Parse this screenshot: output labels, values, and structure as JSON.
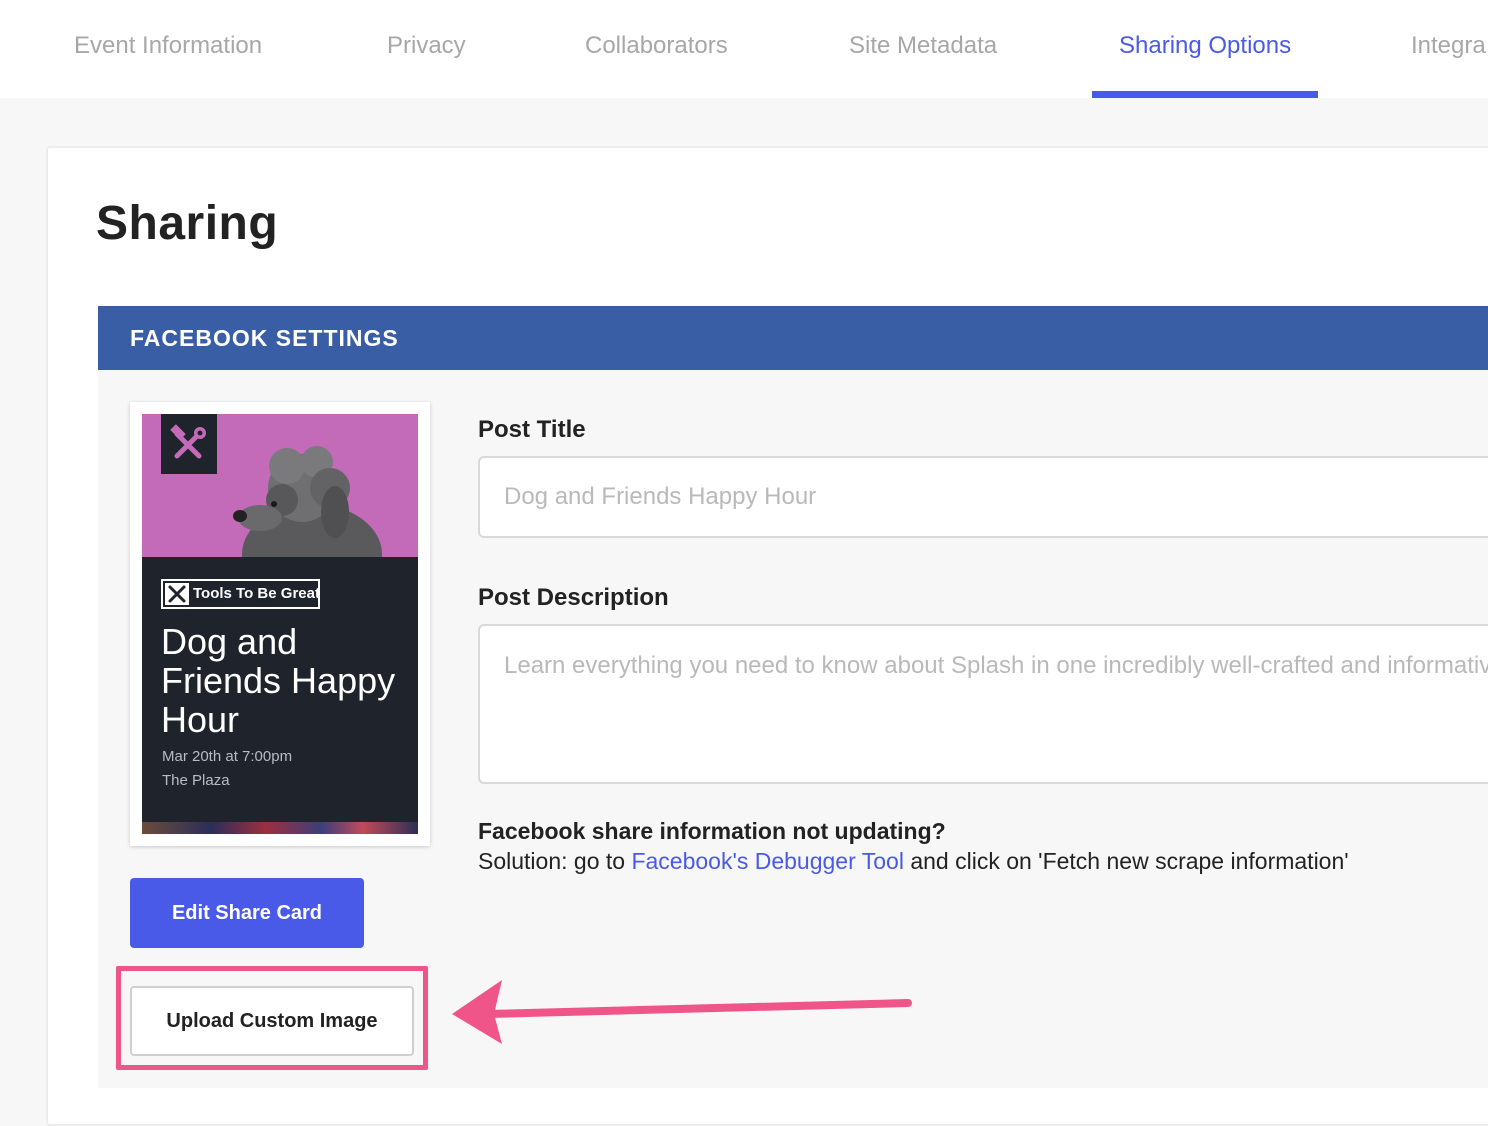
{
  "tabs": [
    {
      "label": "Event Information",
      "active": false
    },
    {
      "label": "Privacy",
      "active": false
    },
    {
      "label": "Collaborators",
      "active": false
    },
    {
      "label": "Site Metadata",
      "active": false
    },
    {
      "label": "Sharing Options",
      "active": true
    },
    {
      "label": "Integra",
      "active": false
    }
  ],
  "page": {
    "title": "Sharing"
  },
  "facebook": {
    "header": "FACEBOOK SETTINGS",
    "share_card": {
      "brand": "Tools To Be Great",
      "event_title": "Dog and Friends Happy Hour",
      "date": "Mar 20th at 7:00pm",
      "venue": "The Plaza"
    },
    "edit_button": "Edit Share Card",
    "upload_button": "Upload Custom Image",
    "post_title_label": "Post Title",
    "post_title_placeholder": "Dog and Friends Happy Hour",
    "post_description_label": "Post Description",
    "post_description_placeholder": "Learn everything you need to know about Splash in one incredibly well-crafted and informative event.",
    "help_heading": "Facebook share information not updating?",
    "help_prefix": "Solution: go to",
    "help_link": "Facebook's Debugger Tool",
    "help_suffix": "and click on 'Fetch new scrape information'"
  },
  "colors": {
    "accent": "#4a5ae8",
    "facebook_header": "#3a5ea5",
    "highlight": "#f0558a",
    "card_dark": "#1f232b",
    "photo_background": "#c36bb9"
  }
}
